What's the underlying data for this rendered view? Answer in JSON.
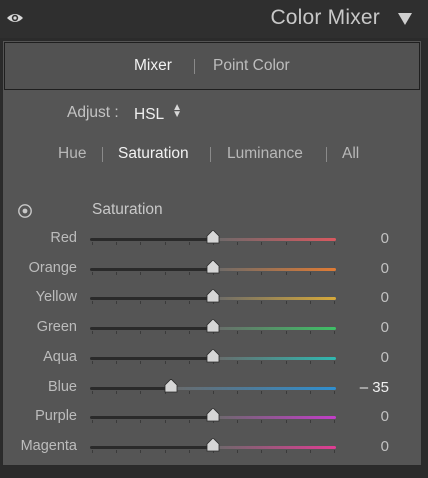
{
  "header": {
    "title": "Color Mixer",
    "eye_icon": "eye-icon",
    "collapse_icon": "triangle-down-icon"
  },
  "mode_tabs": [
    {
      "label": "Mixer",
      "active": true
    },
    {
      "label": "Point Color",
      "active": false
    }
  ],
  "adjust": {
    "label": "Adjust :",
    "value": "HSL"
  },
  "property_tabs": [
    {
      "label": "Hue",
      "active": false
    },
    {
      "label": "Saturation",
      "active": true
    },
    {
      "label": "Luminance",
      "active": false
    },
    {
      "label": "All",
      "active": false
    }
  ],
  "section": {
    "label": "Saturation",
    "target_icon": "target-adjust-icon"
  },
  "slider_range": [
    -100,
    100
  ],
  "sliders": [
    {
      "label": "Red",
      "value": 0,
      "display": "0",
      "color": "#d9585f"
    },
    {
      "label": "Orange",
      "value": 0,
      "display": "0",
      "color": "#e07b34"
    },
    {
      "label": "Yellow",
      "value": 0,
      "display": "0",
      "color": "#d6a93a"
    },
    {
      "label": "Green",
      "value": 0,
      "display": "0",
      "color": "#3ec066"
    },
    {
      "label": "Aqua",
      "value": 0,
      "display": "0",
      "color": "#2fb8b0"
    },
    {
      "label": "Blue",
      "value": -35,
      "display": "– 35",
      "color": "#2f8fd0"
    },
    {
      "label": "Purple",
      "value": 0,
      "display": "0",
      "color": "#c23ec8"
    },
    {
      "label": "Magenta",
      "value": 0,
      "display": "0",
      "color": "#df3d93"
    }
  ]
}
